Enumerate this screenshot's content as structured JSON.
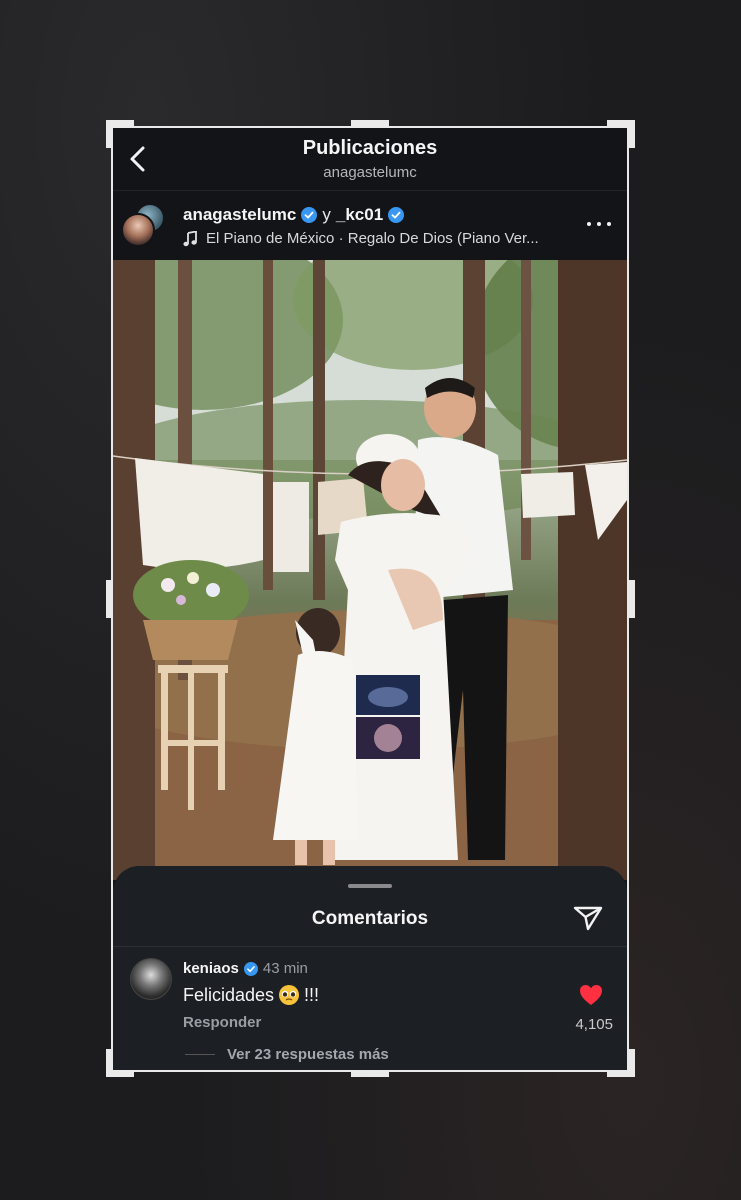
{
  "header": {
    "title": "Publicaciones",
    "subtitle": "anagastelumc"
  },
  "post": {
    "user1": "anagastelumc",
    "connector": "y",
    "user2": "_kc01",
    "music": "El Piano de México · Regalo De Dios (Piano Ver..."
  },
  "comments": {
    "title": "Comentarios",
    "items": [
      {
        "user": "keniaos",
        "time": "43 min",
        "text": "Felicidades",
        "text_suffix": "!!!",
        "reply_label": "Responder",
        "likes": "4,105",
        "replies_label": "Ver 23 respuestas más"
      }
    ]
  },
  "colors": {
    "verified": "#3897f0",
    "like": "#ff3040",
    "background": "#121418",
    "sheet": "#1c1f24"
  },
  "icons": {
    "back": "chevron-left-icon",
    "verified": "verified-badge-icon",
    "music": "music-note-icon",
    "more": "more-horizontal-icon",
    "share": "send-icon",
    "like": "heart-icon",
    "emoji": "pleading-face-emoji"
  }
}
